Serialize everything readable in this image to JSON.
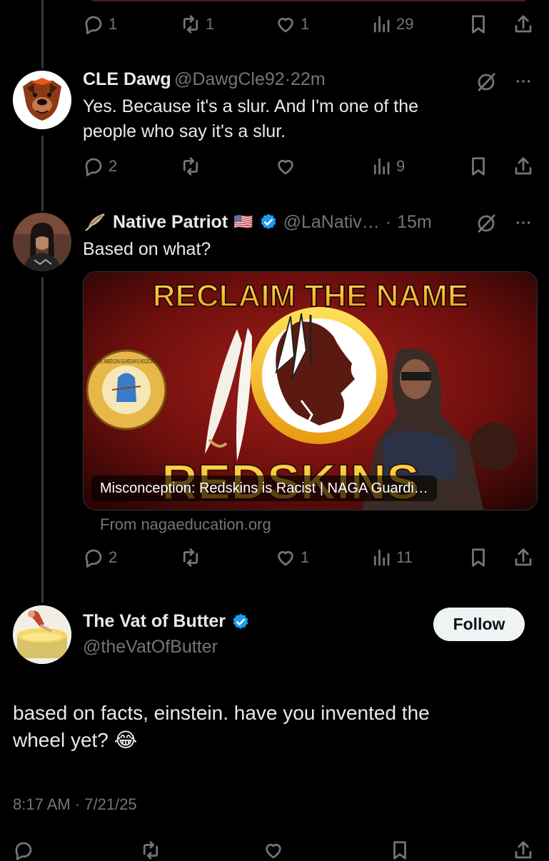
{
  "top_actions": {
    "reply_count": "1",
    "retweet_count": "1",
    "like_count": "1",
    "views_count": "29"
  },
  "tweet1": {
    "display_name": "CLE Dawg",
    "handle": "@DawgCle92",
    "time": "22m",
    "text_line1": "Yes. Because it's a slur. And I'm one of the",
    "text_line2": "people who say it's a slur.",
    "reply_count": "2",
    "retweet_count": "",
    "like_count": "",
    "views_count": "9"
  },
  "tweet2": {
    "display_name": "Native Patriot",
    "flag": "🇺🇸",
    "handle": "@LaNativ…",
    "time": "15m",
    "text": "Based on what?",
    "card": {
      "banner_text": "RECLAIM THE NAME",
      "team_text": "REDSKINS",
      "seal_text": "NATIVE AMERICAN GUARDIAN'S ASSOCIATION",
      "caption": "Misconception: Redskins is Racist | NAGA Guardi…",
      "source": "From nagaeducation.org"
    },
    "reply_count": "2",
    "retweet_count": "",
    "like_count": "1",
    "views_count": "11"
  },
  "main_tweet": {
    "display_name": "The Vat of Butter",
    "handle": "@theVatOfButter",
    "follow_label": "Follow",
    "text_line1": "based on facts, einstein.  have you invented the",
    "text_line2": "wheel yet? 😂",
    "timestamp": "8:17 AM · 7/21/25"
  },
  "colors": {
    "accent_blue": "#1d9bf0",
    "muted": "#71767b",
    "text": "#e7e9ea"
  }
}
